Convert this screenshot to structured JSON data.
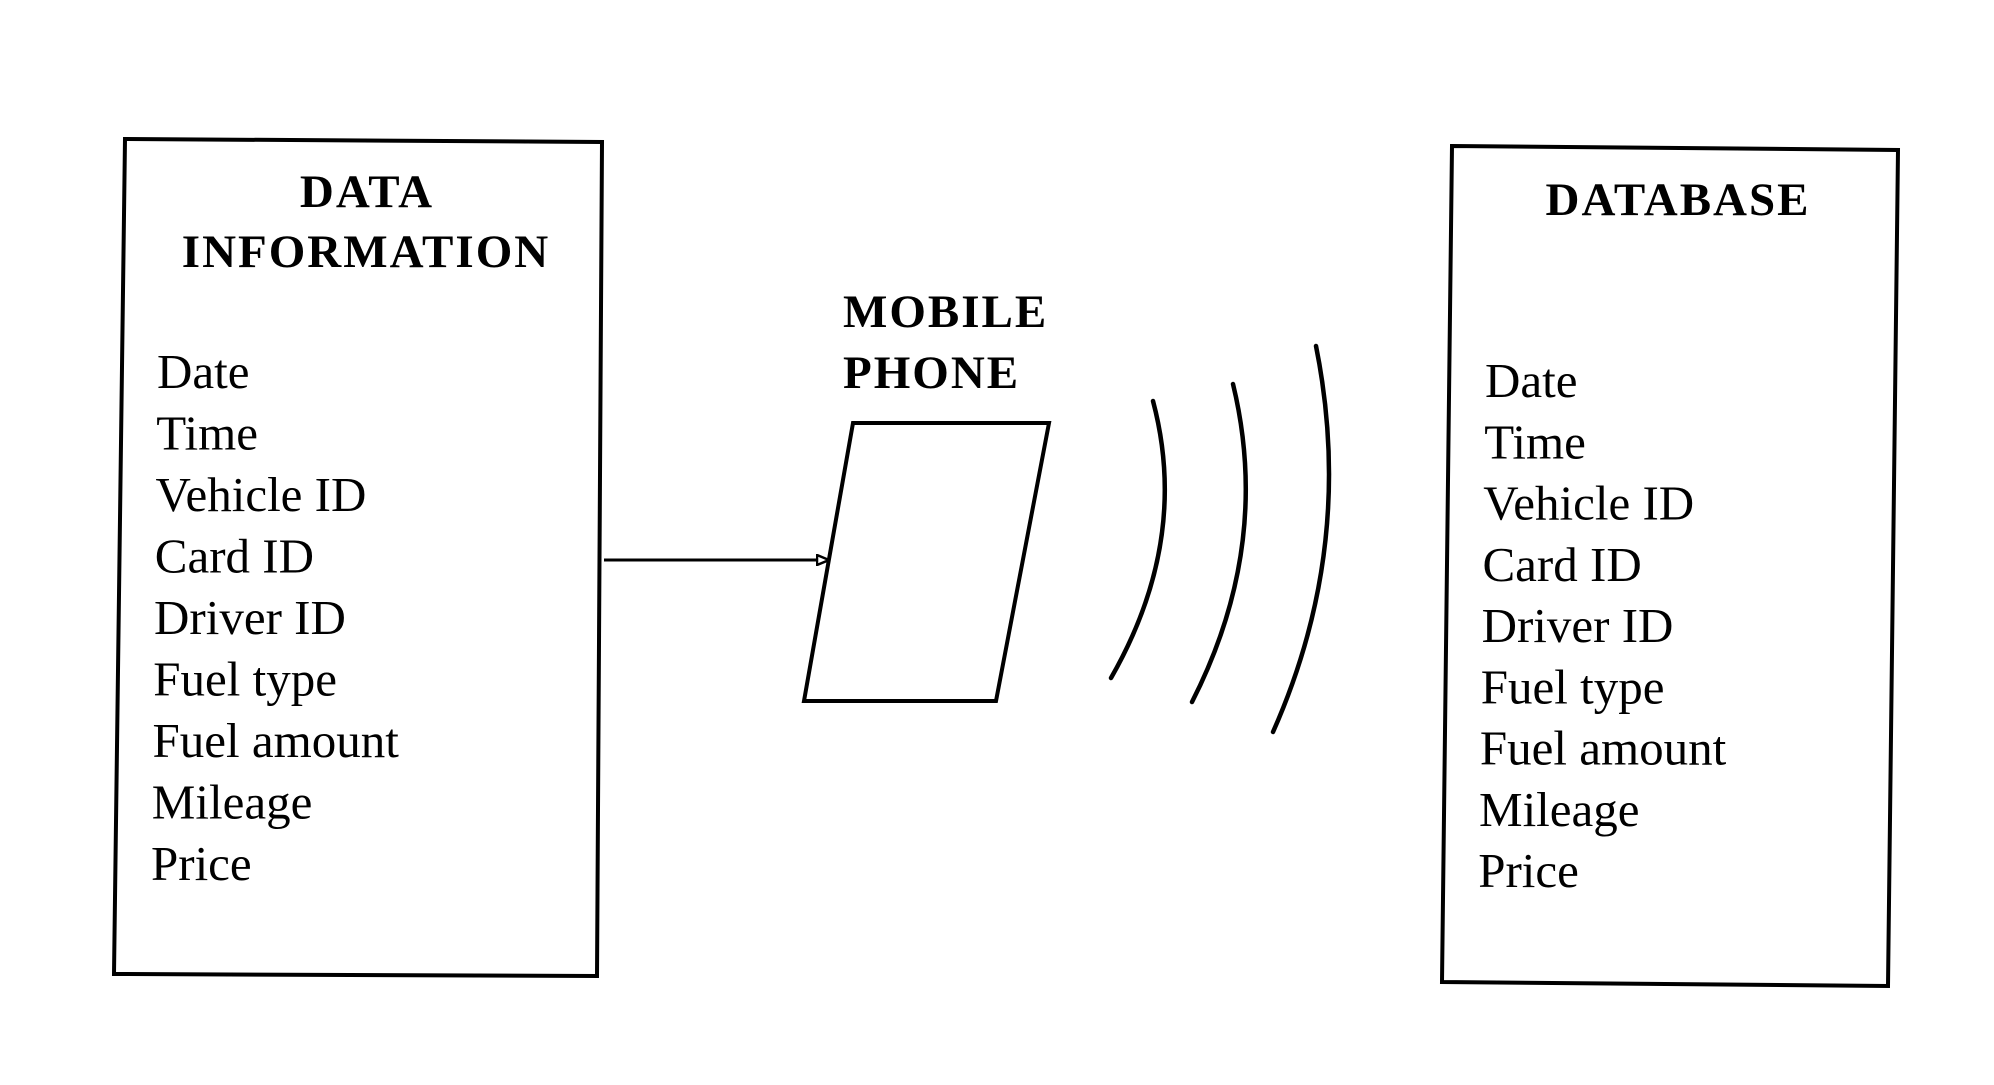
{
  "diagram": {
    "data_information": {
      "title_line1": "DATA",
      "title_line2": "INFORMATION",
      "fields": [
        "Date",
        "Time",
        "Vehicle ID",
        "Card ID",
        "Driver ID",
        "Fuel type",
        "Fuel amount",
        "Mileage",
        "Price"
      ]
    },
    "mobile_phone": {
      "label_line1": "MOBILE",
      "label_line2": "PHONE"
    },
    "wireless_signal": {
      "icon": "wireless-waves-icon",
      "arc_count": 3
    },
    "database": {
      "title": "DATABASE",
      "fields": [
        "Date",
        "Time",
        "Vehicle ID",
        "Card ID",
        "Driver ID",
        "Fuel type",
        "Fuel amount",
        "Mileage",
        "Price"
      ]
    },
    "connections": [
      {
        "from": "data_information",
        "to": "mobile_phone",
        "type": "arrow"
      },
      {
        "from": "mobile_phone",
        "to": "database",
        "type": "wireless"
      }
    ]
  }
}
